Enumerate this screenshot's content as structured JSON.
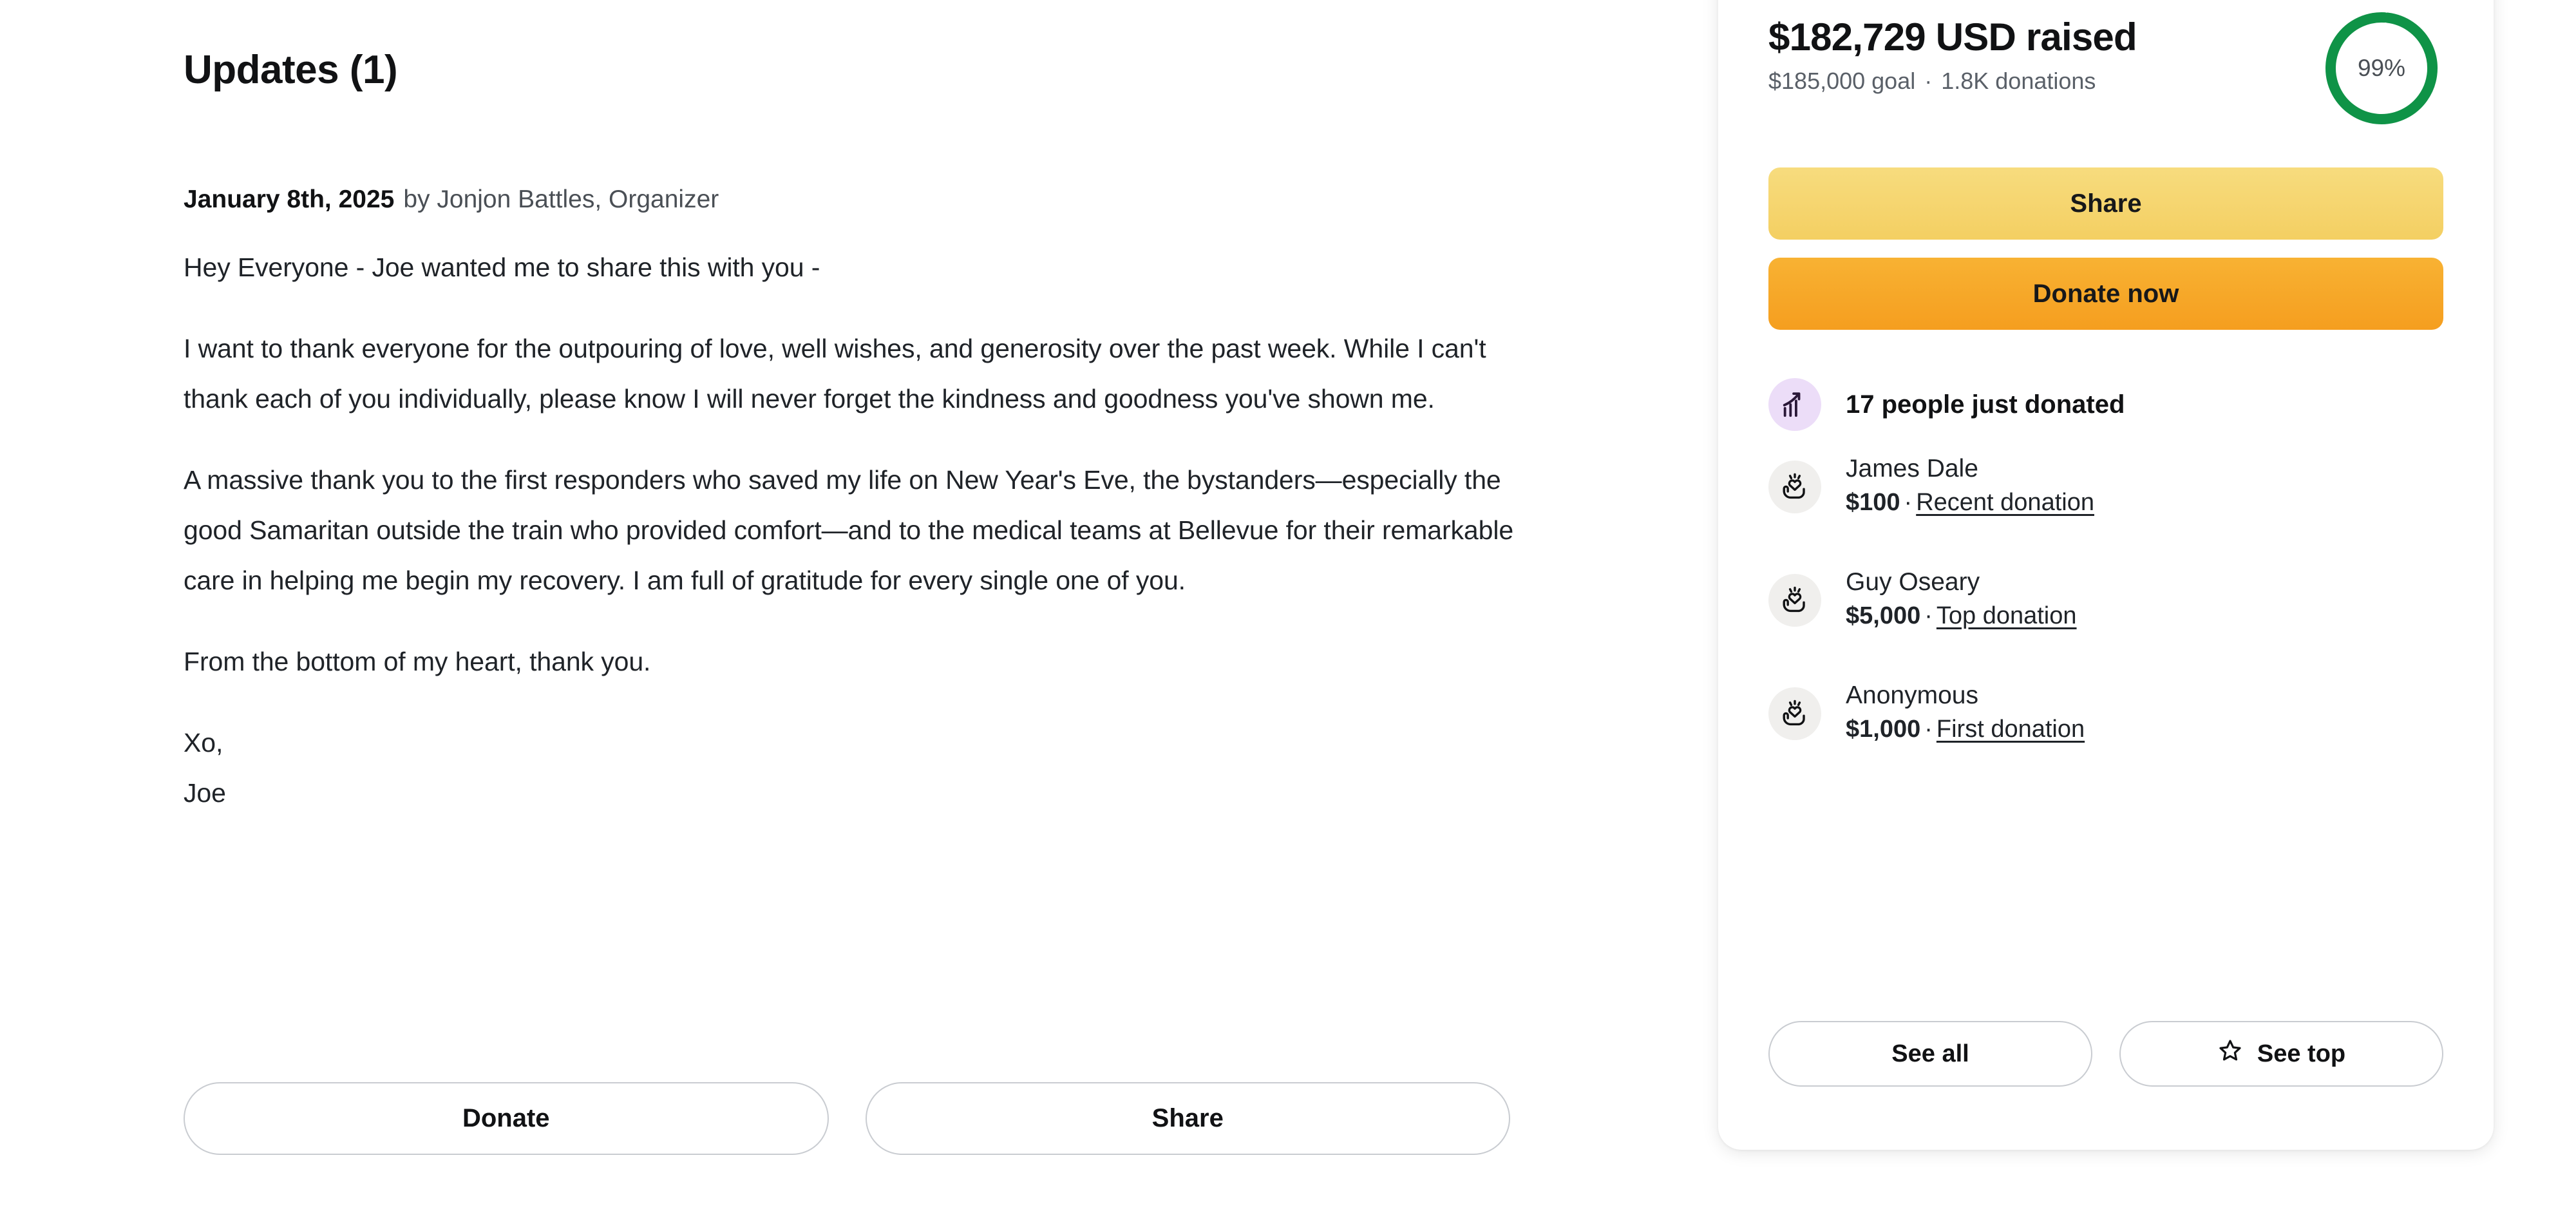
{
  "updates": {
    "section_title": "Updates (1)",
    "date": "January 8th, 2025",
    "author": "by Jonjon Battles, Organizer",
    "paragraphs": [
      "Hey Everyone - Joe wanted me to share this with you -",
      "I want to thank everyone for the outpouring of love, well wishes, and generosity over the past week. While I can't thank each of you individually, please know I will never forget the kindness and goodness you've shown me.",
      "A massive thank you to the first responders who saved my life on New Year's Eve, the bystanders—especially the good Samaritan outside the train who provided comfort—and to the medical teams at Bellevue for their remarkable care in helping me begin my recovery. I am full of gratitude for every single one of you.",
      "From the bottom of my heart, thank you."
    ],
    "signature_line1": "Xo,",
    "signature_line2": "Joe",
    "actions": {
      "donate_label": "Donate",
      "share_label": "Share"
    }
  },
  "sidebar": {
    "raised_amount": "$182,729 USD raised",
    "goal_text": "$185,000 goal",
    "donations_text": "1.8K donations",
    "separator": "·",
    "progress_percent_label": "99%",
    "progress_percent_value": 99,
    "ring_color": "#0f9347",
    "share_button": "Share",
    "donate_button": "Donate now",
    "activity": {
      "icon": "trending-up-icon",
      "text": "17 people just donated",
      "badge_color": "#ecddf8"
    },
    "donors": [
      {
        "icon": "heart-hand-icon",
        "name": "James Dale",
        "amount": "$100",
        "separator": "·",
        "tag": "Recent donation"
      },
      {
        "icon": "heart-hand-icon",
        "name": "Guy Oseary",
        "amount": "$5,000",
        "separator": "·",
        "tag": "Top donation"
      },
      {
        "icon": "heart-hand-icon",
        "name": "Anonymous",
        "amount": "$1,000",
        "separator": "·",
        "tag": "First donation"
      }
    ],
    "see_all_label": "See all",
    "see_top_label": "See top",
    "see_top_icon": "star-icon"
  }
}
